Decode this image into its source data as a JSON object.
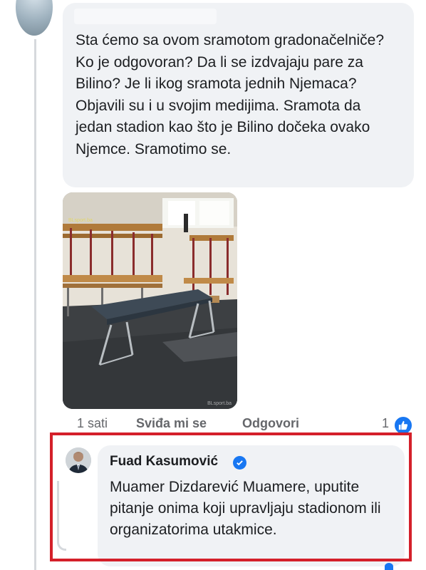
{
  "comment": {
    "text": "Sta ćemo sa ovom sramotom gradonačelniče? Ko je odgovoran? Da li se izdvajaju pare za Bilino? Je li ikog sramota jednih Njemaca? Objavili su i u svojim medijima. Sramota da jedan stadion kao što je Bilino dočeka ovako Njemce. Sramotimo se.",
    "photo_watermark_top": "BLsport.ba",
    "photo_watermark_bottom": "BLsport.ba",
    "actions": {
      "time": "1 sati",
      "like_label": "Sviđa mi se",
      "reply_label": "Odgovori",
      "like_count": "1"
    }
  },
  "reply": {
    "author": "Fuad Kasumović",
    "text": "Muamer Dizdarević Muamere, uputite pitanje onima koji upravljaju stadionom ili organizatorima utakmice."
  },
  "icons": {
    "like": "thumbs-up-icon",
    "verified": "verified-check-icon"
  },
  "colors": {
    "bubble": "#f0f2f5",
    "accent_blue": "#1877f2",
    "highlight_red": "#d4202a",
    "meta_gray": "#65676b"
  }
}
